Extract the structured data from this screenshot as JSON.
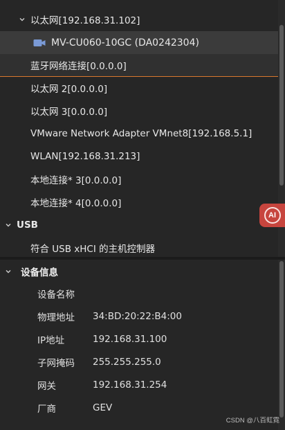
{
  "tree": {
    "ethernet_node": {
      "label": "以太网[192.168.31.102]"
    },
    "camera_item": {
      "label": "MV-CU060-10GC (DA0242304)",
      "icon": "camera-icon"
    },
    "network_items": [
      {
        "label": "蓝牙网络连接[0.0.0.0]"
      },
      {
        "label": "以太网 2[0.0.0.0]"
      },
      {
        "label": "以太网 3[0.0.0.0]"
      },
      {
        "label": "VMware Network Adapter VMnet8[192.168.5.1]"
      },
      {
        "label": "WLAN[192.168.31.213]"
      },
      {
        "label": "本地连接* 3[0.0.0.0]"
      },
      {
        "label": "本地连接* 4[0.0.0.0]"
      }
    ],
    "usb_section": {
      "label": "USB"
    },
    "usb_items": [
      {
        "label": "符合 USB xHCI 的主机控制器"
      }
    ]
  },
  "ai_badge": {
    "label": "AI",
    "color": "#c7453e"
  },
  "device_info": {
    "title": "设备信息",
    "rows": [
      {
        "key": "设备名称",
        "value": ""
      },
      {
        "key": "物理地址",
        "value": "34:BD:20:22:B4:00"
      },
      {
        "key": "IP地址",
        "value": "192.168.31.100"
      },
      {
        "key": "子网掩码",
        "value": "255.255.255.0"
      },
      {
        "key": "网关",
        "value": "192.168.31.254"
      },
      {
        "key": "厂商",
        "value": "GEV"
      }
    ]
  },
  "watermark": "CSDN @八百虹霓",
  "colors": {
    "background": "#262626",
    "selection": "#3b3b3b",
    "focus_underline": "#d9782e",
    "text": "#e6e6e6"
  }
}
